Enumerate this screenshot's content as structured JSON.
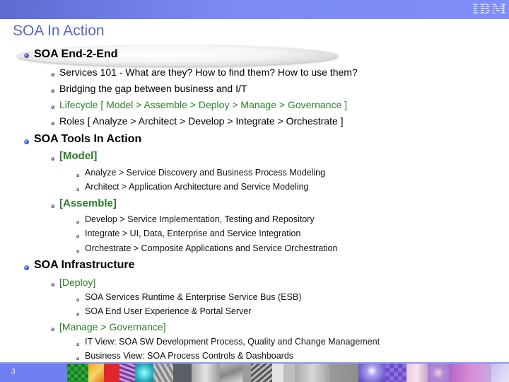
{
  "header": {
    "logo_text": "IBM",
    "bar_color": "#7f8ef8"
  },
  "slide": {
    "title": "SOA In Action",
    "page_number": "3"
  },
  "outline": {
    "sections": [
      {
        "label": "SOA End-2-End",
        "highlighted": true,
        "items": [
          {
            "label": "Services 101 - What are they? How to find them? How to use them?",
            "color": "#000000"
          },
          {
            "label": "Bridging the gap between business and I/T",
            "color": "#000000"
          },
          {
            "label": "Lifecycle [ Model > Assemble > Deploy > Manage > Governance ]",
            "color": "#2e7d2e"
          },
          {
            "label": "Roles [ Analyze > Architect > Develop > Integrate > Orchestrate ]",
            "color": "#000000"
          }
        ]
      },
      {
        "label": "SOA Tools In Action",
        "groups": [
          {
            "label": "[Model]",
            "items": [
              "Analyze > Service Discovery and Business Process Modeling",
              "Architect > Application Architecture and Service Modeling"
            ]
          },
          {
            "label": "[Assemble]",
            "items": [
              "Develop > Service Implementation, Testing and Repository",
              "Integrate > UI, Data, Enterprise and Service Integration",
              "Orchestrate > Composite Applications and Service Orchestration"
            ]
          }
        ]
      },
      {
        "label": "SOA Infrastructure",
        "groups": [
          {
            "label": "[Deploy]",
            "items": [
              "SOA Services Runtime & Enterprise Service Bus (ESB)",
              "SOA End User Experience & Portal Server"
            ]
          },
          {
            "label": "[Manage > Governance]",
            "items": [
              "IT View: SOA SW Development Process, Quality and Change Management",
              "Business View: SOA Process Controls & Dashboards"
            ]
          }
        ]
      }
    ]
  },
  "colors": {
    "title": "#5a64c8",
    "accent_green": "#2e7d2e",
    "footer": "#6f7ef0"
  }
}
